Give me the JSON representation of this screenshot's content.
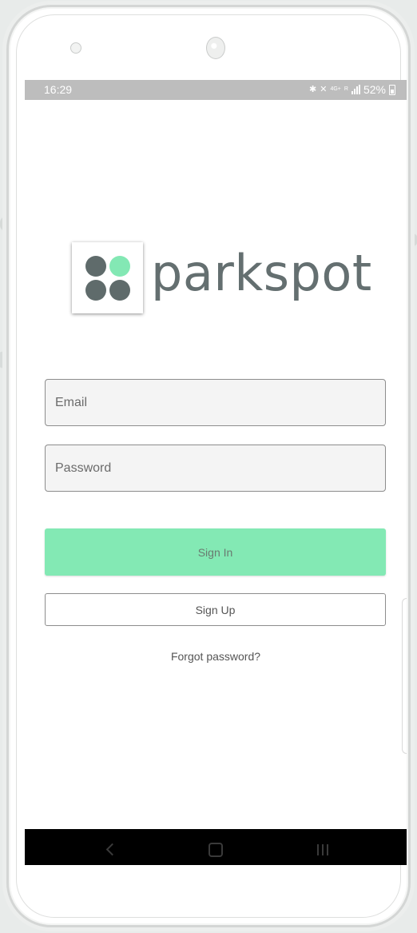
{
  "status_bar": {
    "time": "16:29",
    "network_label": "4G+",
    "signal_label": "R",
    "battery_percent": "52%",
    "icons": [
      "bluetooth-icon",
      "mute-icon",
      "network-icon",
      "signal-icon",
      "battery-icon"
    ]
  },
  "logo": {
    "text": "parkspot",
    "colors": {
      "dark": "#5f6b6b",
      "accent": "#83e8b4"
    }
  },
  "form": {
    "email_placeholder": "Email",
    "email_value": "",
    "password_placeholder": "Password",
    "password_value": ""
  },
  "actions": {
    "sign_in_label": "Sign In",
    "sign_up_label": "Sign Up",
    "forgot_label": "Forgot password?"
  },
  "nav": {
    "icons": [
      "back-icon",
      "home-icon",
      "recent-apps-icon"
    ]
  },
  "colors": {
    "primary_button": "#83e9b4",
    "status_bar": "#bdbdbd",
    "nav_bar": "#000000"
  }
}
